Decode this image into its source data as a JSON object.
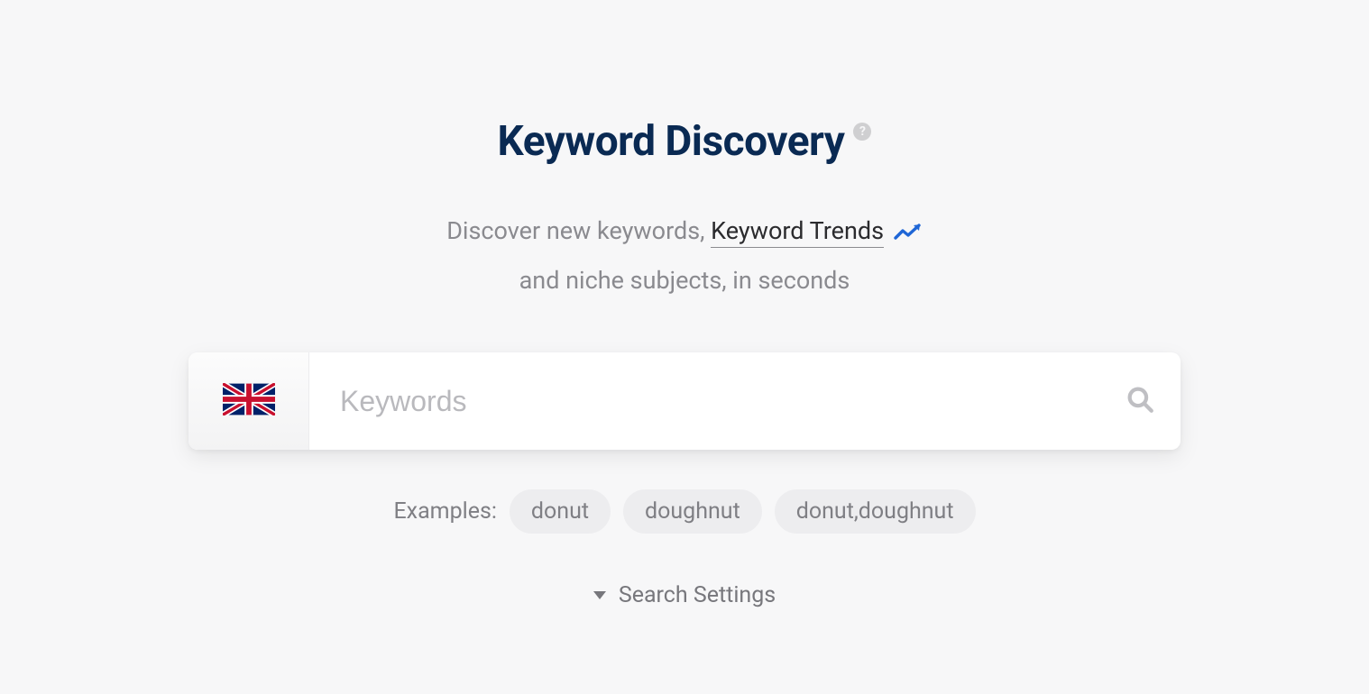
{
  "header": {
    "title": "Keyword Discovery",
    "help_glyph": "?"
  },
  "subtitle": {
    "prefix": "Discover new keywords, ",
    "link": "Keyword Trends",
    "suffix_line": "and niche subjects, in seconds"
  },
  "search": {
    "placeholder": "Keywords",
    "value": "",
    "locale_flag": "uk"
  },
  "examples": {
    "label": "Examples:",
    "items": [
      "donut",
      "doughnut",
      "donut,doughnut"
    ]
  },
  "settings": {
    "label": "Search Settings"
  }
}
